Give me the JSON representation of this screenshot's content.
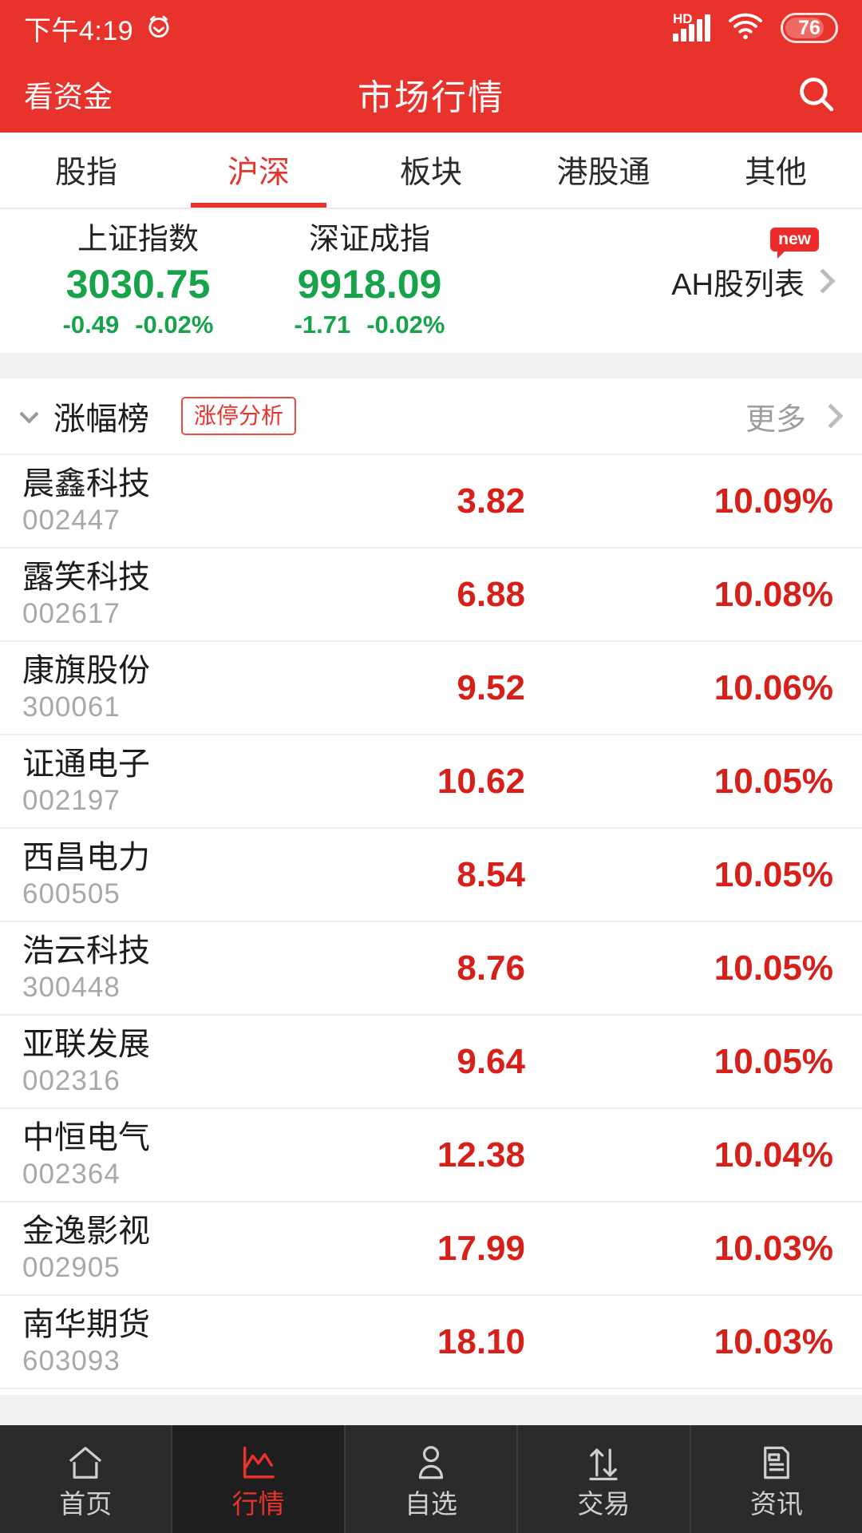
{
  "status_bar": {
    "time": "下午4:19",
    "alarm_icon": "alarm-clock-icon",
    "network_label": "HD",
    "signal_icon": "signal-bars-icon",
    "wifi_icon": "wifi-icon",
    "battery_level": "76"
  },
  "app_bar": {
    "left_action": "看资金",
    "title": "市场行情",
    "search_icon": "search-icon"
  },
  "tabs": [
    {
      "label": "股指",
      "active": false
    },
    {
      "label": "沪深",
      "active": true
    },
    {
      "label": "板块",
      "active": false
    },
    {
      "label": "港股通",
      "active": false
    },
    {
      "label": "其他",
      "active": false
    }
  ],
  "indices": [
    {
      "name": "上证指数",
      "value": "3030.75",
      "change": "-0.49",
      "change_pct": "-0.02%",
      "direction": "down"
    },
    {
      "name": "深证成指",
      "value": "9918.09",
      "change": "-1.71",
      "change_pct": "-0.02%",
      "direction": "down"
    }
  ],
  "ah_entry": {
    "label": "AH股列表",
    "badge": "new",
    "chevron_icon": "chevron-right-icon"
  },
  "section": {
    "collapse_icon": "chevron-down-icon",
    "title": "涨幅榜",
    "tag_button": "涨停分析",
    "more_label": "更多",
    "more_icon": "chevron-right-icon"
  },
  "stocks": [
    {
      "name": "晨鑫科技",
      "code": "002447",
      "price": "3.82",
      "pct": "10.09%"
    },
    {
      "name": "露笑科技",
      "code": "002617",
      "price": "6.88",
      "pct": "10.08%"
    },
    {
      "name": "康旗股份",
      "code": "300061",
      "price": "9.52",
      "pct": "10.06%"
    },
    {
      "name": "证通电子",
      "code": "002197",
      "price": "10.62",
      "pct": "10.05%"
    },
    {
      "name": "西昌电力",
      "code": "600505",
      "price": "8.54",
      "pct": "10.05%"
    },
    {
      "name": "浩云科技",
      "code": "300448",
      "price": "8.76",
      "pct": "10.05%"
    },
    {
      "name": "亚联发展",
      "code": "002316",
      "price": "9.64",
      "pct": "10.05%"
    },
    {
      "name": "中恒电气",
      "code": "002364",
      "price": "12.38",
      "pct": "10.04%"
    },
    {
      "name": "金逸影视",
      "code": "002905",
      "price": "17.99",
      "pct": "10.03%"
    },
    {
      "name": "南华期货",
      "code": "603093",
      "price": "18.10",
      "pct": "10.03%"
    }
  ],
  "bottom_nav": [
    {
      "label": "首页",
      "icon": "home-icon",
      "active": false
    },
    {
      "label": "行情",
      "icon": "chart-icon",
      "active": true
    },
    {
      "label": "自选",
      "icon": "person-icon",
      "active": false
    },
    {
      "label": "交易",
      "icon": "exchange-arrows-icon",
      "active": false
    },
    {
      "label": "资讯",
      "icon": "news-icon",
      "active": false
    }
  ],
  "colors": {
    "brand_red": "#E8322C",
    "up_red": "#D62019",
    "down_green": "#17A34A",
    "nav_dark": "#2B2B2B"
  }
}
